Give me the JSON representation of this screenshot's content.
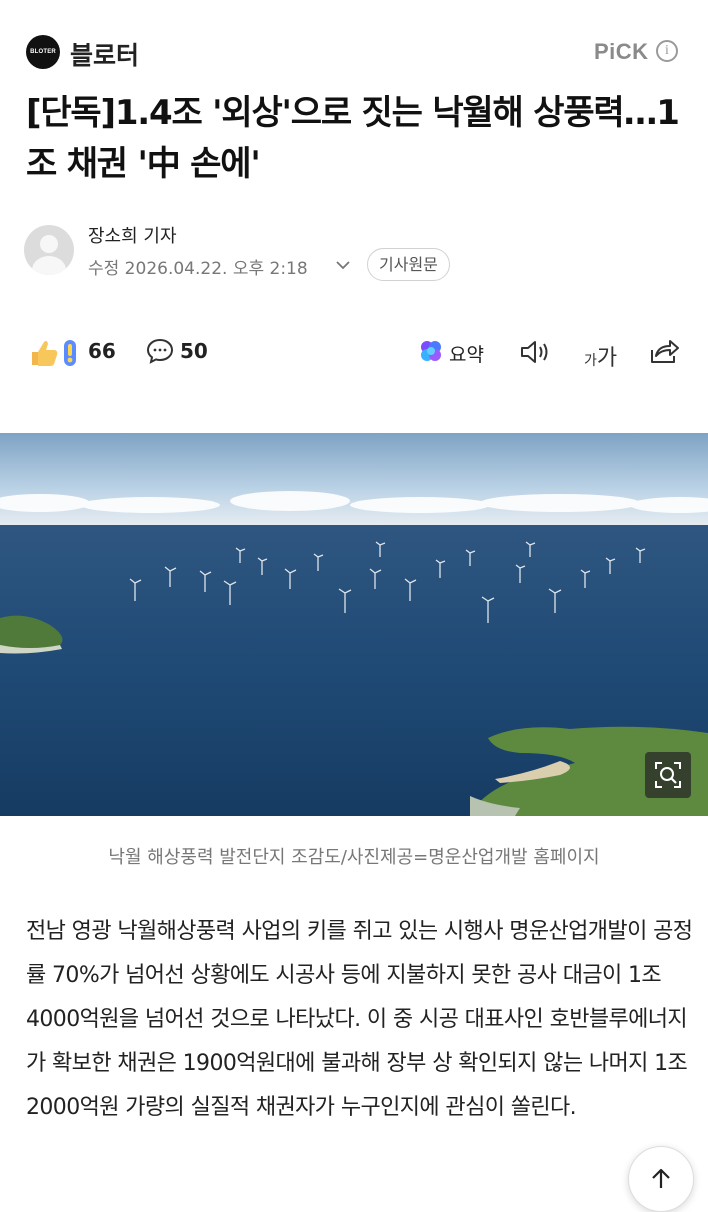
{
  "header": {
    "press_logo_text": "BLOTER",
    "press_name": "블로터",
    "pick_label": "PiCK",
    "info_symbol": "i"
  },
  "article": {
    "title": "[단독]1.4조 '외상'으로 짓는 낙월해 상풍력…1조 채권 '中 손에'",
    "reporter": "장소희 기자",
    "date": "수정 2026.04.22. 오후 2:18",
    "original_button": "기사원문",
    "photo_caption": "낙월 해상풍력 발전단지 조감도/사진제공=명운산업개발 홈페이지",
    "body": "전남 영광 낙월해상풍력 사업의 키를 쥐고 있는 시행사 명운산업개발이 공정률 70%가 넘어선 상황에도 시공사 등에 지불하지 못한 공사 대금이 1조4000억원을 넘어선 것으로 나타났다. 이 중 시공 대표사인 호반블루에너지가 확보한 채권은 1900억원대에 불과해 장부 상 확인되지 않는 나머지 1조2000억원 가량의 실질적 채권자가 누구인지에 관심이 쏠린다."
  },
  "actions": {
    "reaction_count": "66",
    "comment_count": "50",
    "summary_label": "요약",
    "font_small": "가",
    "font_large": "가"
  },
  "icons": [
    "info-icon",
    "avatar-icon",
    "chevron-down-icon",
    "reaction-icon",
    "comment-icon",
    "summary-icon",
    "speaker-icon",
    "font-size-icon",
    "share-icon",
    "zoom-icon",
    "arrow-up-icon"
  ],
  "colors": {
    "text": "#1a1a1a",
    "muted": "#777777",
    "pick_gray": "#8a8a8a",
    "summary_purple": "#7b4bff",
    "summary_blue": "#2f6bff"
  }
}
